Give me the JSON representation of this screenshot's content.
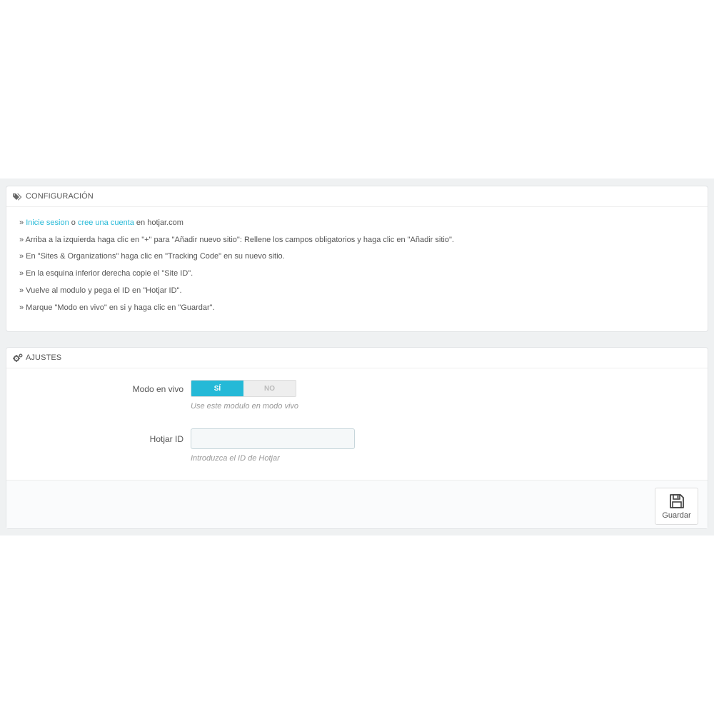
{
  "config_panel": {
    "title": "Configuración",
    "icon": "tags-icon",
    "steps": [
      {
        "prefix": "» ",
        "link1": "Inicie sesion",
        "mid": " o ",
        "link2": "cree una cuenta",
        "suffix": " en hotjar.com"
      },
      {
        "text": "» Arriba a la izquierda haga clic en \"+\" para \"Añadir nuevo sitio\": Rellene los campos obligatorios y haga clic en \"Añadir sitio\"."
      },
      {
        "text": "» En \"Sites & Organizations\" haga clic en \"Tracking Code\" en su nuevo sitio."
      },
      {
        "text": "» En la esquina inferior derecha copie el \"Site ID\"."
      },
      {
        "text": "» Vuelve al modulo y pega el ID en \"Hotjar ID\"."
      },
      {
        "text": "» Marque \"Modo en vivo\" en si y haga clic en \"Guardar\"."
      }
    ]
  },
  "settings_panel": {
    "title": "Ajustes",
    "icon": "cogs-icon",
    "live_mode": {
      "label": "Modo en vivo",
      "on_label": "SÍ",
      "off_label": "NO",
      "selected": "SÍ",
      "help": "Use este modulo en modo vivo"
    },
    "hotjar_id": {
      "label": "Hotjar ID",
      "value": "",
      "help": "Introduzca el ID de Hotjar"
    },
    "save_label": "Guardar",
    "save_icon": "save-icon"
  },
  "colors": {
    "accent": "#25b9d7",
    "background_band": "#eff1f2"
  }
}
